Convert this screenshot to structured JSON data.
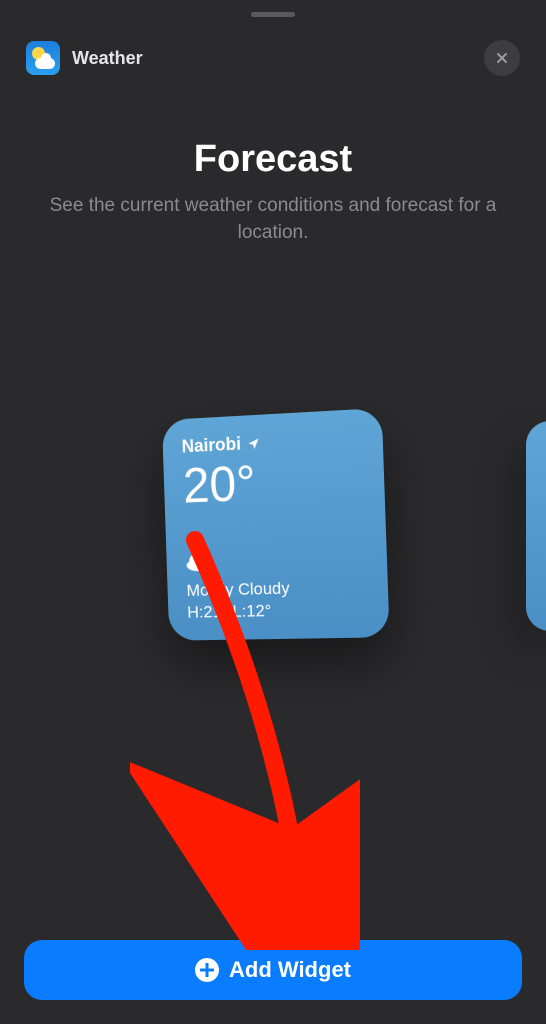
{
  "header": {
    "app_name": "Weather"
  },
  "title": "Forecast",
  "subtitle": "See the current weather conditions and forecast for a location.",
  "widget": {
    "location": "Nairobi",
    "temperature": "20°",
    "condition": "Mostly Cloudy",
    "high_low": "H:21° L:12°"
  },
  "pager": {
    "count": 2,
    "active": 0
  },
  "actions": {
    "add_label": "Add Widget"
  },
  "colors": {
    "accent": "#0a7cff",
    "widget_top": "#5fa5d6",
    "widget_bottom": "#4a8fc5",
    "annotation_red": "#ff1a00"
  }
}
